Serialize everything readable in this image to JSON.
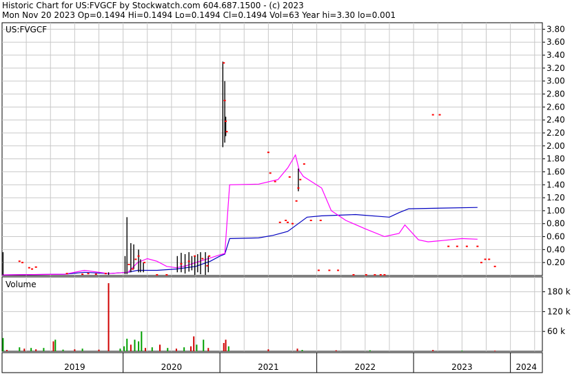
{
  "header": {
    "line1": "Historic Chart for US:FVGCF by Stockwatch.com 604.687.1500 - (c) 2023",
    "line2": "Mon Nov 20 2023   Op=0.1494  Hi=0.1494  Lo=0.1494  Cl=0.1494  Vol=63  Year hi=3.30  lo=0.001"
  },
  "colors": {
    "background": "#ffffff",
    "grid": "#c8c8c8",
    "price": "#000000",
    "close_marker": "#ff0000",
    "ma_fast": "#ff00ff",
    "ma_slow": "#0000c0",
    "volume_up": "#00a000",
    "volume_down": "#d00000"
  },
  "chart_data": [
    {
      "type": "line",
      "title": "US:FVGCF",
      "ylim": [
        0,
        3.9
      ],
      "y_ticks": [
        "0.20",
        "0.40",
        "0.60",
        "0.80",
        "1.00",
        "1.20",
        "1.40",
        "1.60",
        "1.80",
        "2.00",
        "2.20",
        "2.40",
        "2.60",
        "2.80",
        "3.00",
        "3.20",
        "3.40",
        "3.60",
        "3.80"
      ],
      "x_range": [
        2018.75,
        2024.33
      ],
      "x_ticks": [
        "2019",
        "2020",
        "2021",
        "2022",
        "2023",
        "2024"
      ],
      "grid": true,
      "series": [
        {
          "style": "price-bars",
          "bars": [
            {
              "x": 2018.76,
              "lo": 0.01,
              "hi": 0.36
            },
            {
              "x": 2019.85,
              "lo": 0.01,
              "hi": 0.05
            },
            {
              "x": 2020.02,
              "lo": 0.02,
              "hi": 0.3
            },
            {
              "x": 2020.04,
              "lo": 0.02,
              "hi": 0.9
            },
            {
              "x": 2020.08,
              "lo": 0.05,
              "hi": 0.5
            },
            {
              "x": 2020.11,
              "lo": 0.1,
              "hi": 0.48
            },
            {
              "x": 2020.16,
              "lo": 0.05,
              "hi": 0.4
            },
            {
              "x": 2020.18,
              "lo": 0.05,
              "hi": 0.25
            },
            {
              "x": 2020.21,
              "lo": 0.05,
              "hi": 0.2
            },
            {
              "x": 2020.56,
              "lo": 0.05,
              "hi": 0.3
            },
            {
              "x": 2020.6,
              "lo": 0.05,
              "hi": 0.35
            },
            {
              "x": 2020.64,
              "lo": 0.03,
              "hi": 0.33
            },
            {
              "x": 2020.68,
              "lo": 0.06,
              "hi": 0.36
            },
            {
              "x": 2020.71,
              "lo": 0.08,
              "hi": 0.3
            },
            {
              "x": 2020.74,
              "lo": 0.01,
              "hi": 0.3
            },
            {
              "x": 2020.77,
              "lo": 0.05,
              "hi": 0.33
            },
            {
              "x": 2020.8,
              "lo": 0.02,
              "hi": 0.36
            },
            {
              "x": 2020.85,
              "lo": 0.01,
              "hi": 0.36
            },
            {
              "x": 2020.88,
              "lo": 0.05,
              "hi": 0.3
            },
            {
              "x": 2021.03,
              "lo": 1.98,
              "hi": 3.3
            },
            {
              "x": 2021.05,
              "lo": 2.05,
              "hi": 3.0
            },
            {
              "x": 2021.06,
              "lo": 2.15,
              "hi": 2.45
            },
            {
              "x": 2021.81,
              "lo": 1.3,
              "hi": 1.65
            }
          ]
        },
        {
          "name": "close",
          "style": "markers",
          "points": [
            [
              2018.93,
              0.22
            ],
            [
              2018.96,
              0.2
            ],
            [
              2019.03,
              0.12
            ],
            [
              2019.06,
              0.1
            ],
            [
              2019.1,
              0.13
            ],
            [
              2019.42,
              0.03
            ],
            [
              2019.58,
              0.02
            ],
            [
              2019.64,
              0.03
            ],
            [
              2019.72,
              0.02
            ],
            [
              2019.82,
              0.03
            ],
            [
              2020.06,
              0.17
            ],
            [
              2020.1,
              0.1
            ],
            [
              2020.13,
              0.25
            ],
            [
              2020.16,
              0.3
            ],
            [
              2020.22,
              0.2
            ],
            [
              2020.35,
              0.01
            ],
            [
              2020.45,
              0.01
            ],
            [
              2020.6,
              0.18
            ],
            [
              2020.68,
              0.22
            ],
            [
              2020.74,
              0.3
            ],
            [
              2020.82,
              0.26
            ],
            [
              2020.87,
              0.15
            ],
            [
              2020.89,
              0.3
            ],
            [
              2021.04,
              3.28
            ],
            [
              2021.05,
              2.7
            ],
            [
              2021.06,
              2.38
            ],
            [
              2021.07,
              2.22
            ],
            [
              2021.5,
              1.9
            ],
            [
              2021.52,
              1.58
            ],
            [
              2021.57,
              1.45
            ],
            [
              2021.72,
              1.52
            ],
            [
              2021.79,
              1.15
            ],
            [
              2021.81,
              1.35
            ],
            [
              2021.83,
              1.48
            ],
            [
              2021.87,
              1.72
            ],
            [
              2021.62,
              0.82
            ],
            [
              2021.68,
              0.85
            ],
            [
              2021.7,
              0.82
            ],
            [
              2021.75,
              0.8
            ],
            [
              2021.94,
              0.85
            ],
            [
              2022.04,
              0.85
            ],
            [
              2022.02,
              0.08
            ],
            [
              2022.13,
              0.08
            ],
            [
              2022.22,
              0.08
            ],
            [
              2022.38,
              0.01
            ],
            [
              2022.51,
              0.01
            ],
            [
              2022.6,
              0.01
            ],
            [
              2022.66,
              0.01
            ],
            [
              2022.7,
              0.01
            ],
            [
              2023.2,
              2.48
            ],
            [
              2023.27,
              2.48
            ],
            [
              2023.36,
              0.45
            ],
            [
              2023.45,
              0.45
            ],
            [
              2023.55,
              0.45
            ],
            [
              2023.66,
              0.45
            ],
            [
              2023.7,
              0.2
            ],
            [
              2023.74,
              0.25
            ],
            [
              2023.78,
              0.25
            ],
            [
              2023.84,
              0.14
            ]
          ]
        },
        {
          "name": "moving-average-fast",
          "points": [
            [
              2018.75,
              0.01
            ],
            [
              2019.4,
              0.02
            ],
            [
              2019.6,
              0.08
            ],
            [
              2019.85,
              0.03
            ],
            [
              2020.05,
              0.05
            ],
            [
              2020.15,
              0.2
            ],
            [
              2020.25,
              0.26
            ],
            [
              2020.35,
              0.22
            ],
            [
              2020.45,
              0.14
            ],
            [
              2020.55,
              0.12
            ],
            [
              2020.65,
              0.15
            ],
            [
              2020.75,
              0.2
            ],
            [
              2020.9,
              0.27
            ],
            [
              2021.0,
              0.32
            ],
            [
              2021.05,
              0.34
            ],
            [
              2021.1,
              1.4
            ],
            [
              2021.4,
              1.41
            ],
            [
              2021.6,
              1.48
            ],
            [
              2021.7,
              1.66
            ],
            [
              2021.78,
              1.86
            ],
            [
              2021.82,
              1.62
            ],
            [
              2021.86,
              1.53
            ],
            [
              2022.05,
              1.35
            ],
            [
              2022.15,
              1.0
            ],
            [
              2022.3,
              0.85
            ],
            [
              2022.5,
              0.72
            ],
            [
              2022.7,
              0.6
            ],
            [
              2022.85,
              0.65
            ],
            [
              2022.91,
              0.78
            ],
            [
              2023.05,
              0.55
            ],
            [
              2023.15,
              0.52
            ],
            [
              2023.3,
              0.54
            ],
            [
              2023.5,
              0.57
            ],
            [
              2023.66,
              0.56
            ]
          ]
        },
        {
          "name": "moving-average-slow",
          "points": [
            [
              2018.75,
              0.01
            ],
            [
              2019.4,
              0.02
            ],
            [
              2019.6,
              0.05
            ],
            [
              2019.85,
              0.03
            ],
            [
              2020.05,
              0.05
            ],
            [
              2020.15,
              0.08
            ],
            [
              2020.35,
              0.08
            ],
            [
              2020.55,
              0.1
            ],
            [
              2020.75,
              0.14
            ],
            [
              2020.9,
              0.22
            ],
            [
              2021.0,
              0.3
            ],
            [
              2021.05,
              0.33
            ],
            [
              2021.1,
              0.57
            ],
            [
              2021.4,
              0.58
            ],
            [
              2021.55,
              0.62
            ],
            [
              2021.7,
              0.68
            ],
            [
              2021.8,
              0.79
            ],
            [
              2021.9,
              0.9
            ],
            [
              2022.05,
              0.92
            ],
            [
              2022.4,
              0.94
            ],
            [
              2022.75,
              0.9
            ],
            [
              2022.85,
              0.97
            ],
            [
              2022.95,
              1.03
            ],
            [
              2023.3,
              1.04
            ],
            [
              2023.66,
              1.05
            ]
          ]
        }
      ]
    },
    {
      "type": "bar",
      "title": "Volume",
      "ylim": [
        0,
        225000
      ],
      "y_ticks": [
        "60 k",
        "120 k",
        "180 k"
      ],
      "x_range": [
        2018.75,
        2024.33
      ],
      "bars": [
        {
          "x": 2018.76,
          "v": 40000,
          "up": true
        },
        {
          "x": 2018.8,
          "v": 4000,
          "up": false
        },
        {
          "x": 2018.93,
          "v": 12000,
          "up": true
        },
        {
          "x": 2018.98,
          "v": 8000,
          "up": false
        },
        {
          "x": 2019.05,
          "v": 10000,
          "up": true
        },
        {
          "x": 2019.1,
          "v": 6000,
          "up": false
        },
        {
          "x": 2019.18,
          "v": 10000,
          "up": true
        },
        {
          "x": 2019.28,
          "v": 30000,
          "up": false
        },
        {
          "x": 2019.3,
          "v": 35000,
          "up": true
        },
        {
          "x": 2019.38,
          "v": 5000,
          "up": true
        },
        {
          "x": 2019.5,
          "v": 6000,
          "up": false
        },
        {
          "x": 2019.58,
          "v": 8000,
          "up": true
        },
        {
          "x": 2019.75,
          "v": 5000,
          "up": false
        },
        {
          "x": 2019.85,
          "v": 206000,
          "up": false
        },
        {
          "x": 2019.97,
          "v": 8000,
          "up": true
        },
        {
          "x": 2020.01,
          "v": 15000,
          "up": true
        },
        {
          "x": 2020.04,
          "v": 38000,
          "up": true
        },
        {
          "x": 2020.08,
          "v": 20000,
          "up": false
        },
        {
          "x": 2020.12,
          "v": 35000,
          "up": true
        },
        {
          "x": 2020.16,
          "v": 30000,
          "up": true
        },
        {
          "x": 2020.19,
          "v": 60000,
          "up": true
        },
        {
          "x": 2020.23,
          "v": 10000,
          "up": false
        },
        {
          "x": 2020.3,
          "v": 12000,
          "up": true
        },
        {
          "x": 2020.38,
          "v": 20000,
          "up": false
        },
        {
          "x": 2020.46,
          "v": 10000,
          "up": true
        },
        {
          "x": 2020.55,
          "v": 8000,
          "up": false
        },
        {
          "x": 2020.63,
          "v": 12000,
          "up": true
        },
        {
          "x": 2020.7,
          "v": 15000,
          "up": false
        },
        {
          "x": 2020.73,
          "v": 45000,
          "up": false
        },
        {
          "x": 2020.76,
          "v": 20000,
          "up": true
        },
        {
          "x": 2020.83,
          "v": 35000,
          "up": true
        },
        {
          "x": 2020.88,
          "v": 10000,
          "up": false
        },
        {
          "x": 2021.04,
          "v": 25000,
          "up": false
        },
        {
          "x": 2021.06,
          "v": 35000,
          "up": false
        },
        {
          "x": 2021.09,
          "v": 15000,
          "up": true
        },
        {
          "x": 2021.5,
          "v": 6000,
          "up": false
        },
        {
          "x": 2021.8,
          "v": 8000,
          "up": false
        },
        {
          "x": 2021.85,
          "v": 4000,
          "up": true
        },
        {
          "x": 2022.2,
          "v": 3000,
          "up": false
        },
        {
          "x": 2022.55,
          "v": 3000,
          "up": true
        },
        {
          "x": 2023.2,
          "v": 4000,
          "up": false
        },
        {
          "x": 2023.5,
          "v": 2000,
          "up": true
        },
        {
          "x": 2023.84,
          "v": 2000,
          "up": false
        }
      ]
    }
  ]
}
